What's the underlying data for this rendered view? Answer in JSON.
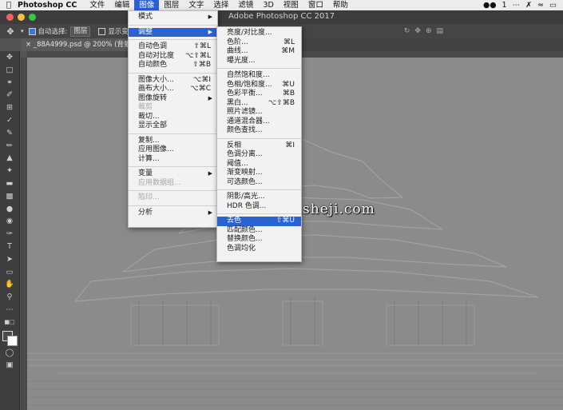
{
  "menubar": {
    "apple": "",
    "app": "Photoshop CC",
    "items": [
      "文件",
      "编辑",
      "图像",
      "图层",
      "文字",
      "选择",
      "滤镜",
      "3D",
      "视图",
      "窗口",
      "帮助"
    ],
    "badge": "1"
  },
  "titlebar": {
    "title": "Adobe Photoshop CC 2017"
  },
  "options_bar": {
    "auto_select_label": "自动选择:",
    "auto_select_value": "图层",
    "show_transform": "显示变"
  },
  "document_tab": {
    "label": "_88A4999.psd @ 200% (背景 拷贝"
  },
  "watermark": {
    "text": "www.haoyidiansheji.com"
  },
  "image_menu": {
    "items": [
      {
        "label": "模式",
        "shortcut": "",
        "submenu": true
      },
      {
        "label": "调整",
        "shortcut": "",
        "submenu": true,
        "highlight": true
      },
      {
        "label": "自动色调",
        "shortcut": "⇧⌘L"
      },
      {
        "label": "自动对比度",
        "shortcut": "⌥⇧⌘L"
      },
      {
        "label": "自动颜色",
        "shortcut": "⇧⌘B"
      },
      {
        "label": "图像大小...",
        "shortcut": "⌥⌘I"
      },
      {
        "label": "画布大小...",
        "shortcut": "⌥⌘C"
      },
      {
        "label": "图像旋转",
        "shortcut": "",
        "submenu": true
      },
      {
        "label": "裁剪",
        "shortcut": "",
        "disabled": true
      },
      {
        "label": "裁切...",
        "shortcut": ""
      },
      {
        "label": "显示全部",
        "shortcut": ""
      },
      {
        "label": "复制...",
        "shortcut": ""
      },
      {
        "label": "应用图像...",
        "shortcut": ""
      },
      {
        "label": "计算...",
        "shortcut": ""
      },
      {
        "label": "变量",
        "shortcut": "",
        "submenu": true
      },
      {
        "label": "应用数据组...",
        "shortcut": "",
        "disabled": true
      },
      {
        "label": "陷印...",
        "shortcut": "",
        "disabled": true
      },
      {
        "label": "分析",
        "shortcut": "",
        "submenu": true
      }
    ]
  },
  "adjust_menu": {
    "items": [
      {
        "label": "亮度/对比度...",
        "shortcut": ""
      },
      {
        "label": "色阶...",
        "shortcut": "⌘L"
      },
      {
        "label": "曲线...",
        "shortcut": "⌘M"
      },
      {
        "label": "曝光度...",
        "shortcut": ""
      },
      {
        "label": "自然饱和度...",
        "shortcut": ""
      },
      {
        "label": "色相/饱和度...",
        "shortcut": "⌘U"
      },
      {
        "label": "色彩平衡...",
        "shortcut": "⌘B"
      },
      {
        "label": "黑白...",
        "shortcut": "⌥⇧⌘B"
      },
      {
        "label": "照片滤镜...",
        "shortcut": ""
      },
      {
        "label": "通道混合器...",
        "shortcut": ""
      },
      {
        "label": "颜色查找...",
        "shortcut": ""
      },
      {
        "label": "反相",
        "shortcut": "⌘I"
      },
      {
        "label": "色调分离...",
        "shortcut": ""
      },
      {
        "label": "阈值...",
        "shortcut": ""
      },
      {
        "label": "渐变映射...",
        "shortcut": ""
      },
      {
        "label": "可选颜色...",
        "shortcut": ""
      },
      {
        "label": "阴影/高光...",
        "shortcut": ""
      },
      {
        "label": "HDR 色调...",
        "shortcut": ""
      },
      {
        "label": "去色",
        "shortcut": "⇧⌘U",
        "highlight": true
      },
      {
        "label": "匹配颜色...",
        "shortcut": ""
      },
      {
        "label": "替换颜色...",
        "shortcut": ""
      },
      {
        "label": "色调均化",
        "shortcut": ""
      }
    ]
  },
  "colors": {
    "menu_highlight": "#2a62d4",
    "canvas_gray": "#8a8a8a"
  }
}
